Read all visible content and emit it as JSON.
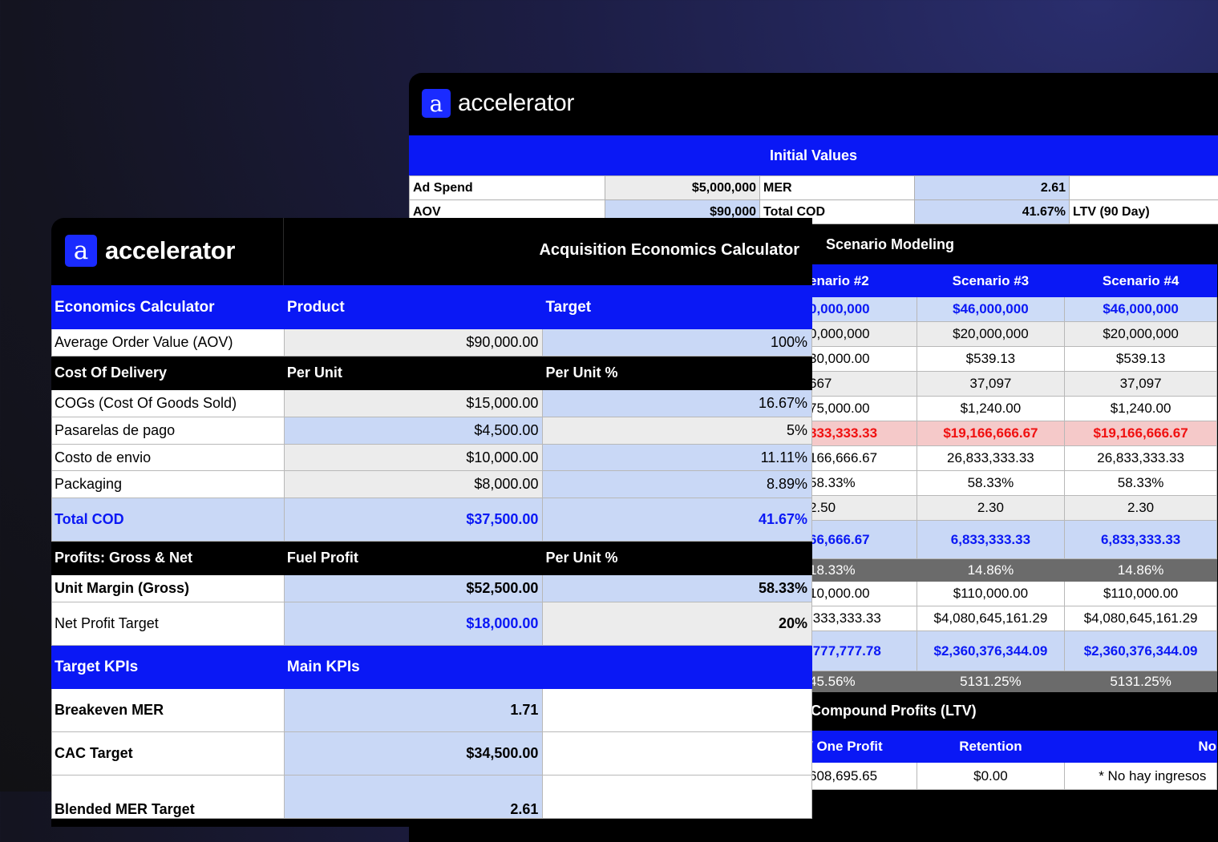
{
  "brand": {
    "mark": "a",
    "name": "accelerator"
  },
  "initial_values": {
    "header": "Initial Values",
    "rows": [
      {
        "l1": "Ad Spend",
        "v1": "$5,000,000",
        "l2": "MER",
        "v2": "2.61",
        "l3": ""
      },
      {
        "l1": "AOV",
        "v1": "$90,000",
        "l2": "Total COD",
        "v2": "41.67%",
        "l3": "LTV (90 Day)"
      }
    ]
  },
  "scenario": {
    "title": "Scenario Modeling",
    "headers": [
      "enario #2",
      "Scenario #3",
      "Scenario #4"
    ],
    "rows": [
      {
        "style": "r-lb",
        "cells": [
          "0,000,000",
          "$46,000,000",
          "$46,000,000"
        ]
      },
      {
        "style": "r-g",
        "cells": [
          "0,000,000",
          "$20,000,000",
          "$20,000,000"
        ]
      },
      {
        "style": "r-w",
        "cells": [
          "30,000.00",
          "$539.13",
          "$539.13"
        ]
      },
      {
        "style": "r-g",
        "cells": [
          "667",
          "37,097",
          "37,097"
        ]
      },
      {
        "style": "r-w",
        "cells": [
          "75,000.00",
          "$1,240.00",
          "$1,240.00"
        ]
      },
      {
        "style": "r-red",
        "cells": [
          "833,333.33",
          "$19,166,666.67",
          "$19,166,666.67"
        ]
      },
      {
        "style": "r-w",
        "cells": [
          "166,666.67",
          "26,833,333.33",
          "26,833,333.33"
        ]
      },
      {
        "style": "r-w",
        "cells": [
          "58.33%",
          "58.33%",
          "58.33%"
        ]
      },
      {
        "style": "r-g",
        "cells": [
          "2.50",
          "2.30",
          "2.30"
        ]
      },
      {
        "style": "r-blue",
        "cells": [
          "66,666.67",
          "6,833,333.33",
          "6,833,333.33"
        ]
      },
      {
        "style": "r-dark",
        "cells": [
          "18.33%",
          "14.86%",
          "14.86%"
        ]
      },
      {
        "style": "r-w",
        "cells": [
          "10,000.00",
          "$110,000.00",
          "$110,000.00"
        ]
      },
      {
        "style": "r-w",
        "cells": [
          ",333,333.33",
          "$4,080,645,161.29",
          "$4,080,645,161.29"
        ]
      },
      {
        "style": "r-blue2",
        "cells": [
          ",777,777.78",
          "$2,360,376,344.09",
          "$2,360,376,344.09"
        ]
      },
      {
        "style": "r-dark2",
        "cells": [
          "45.56%",
          "5131.25%",
          "5131.25%"
        ]
      }
    ],
    "ltv_title": "Compound Profits (LTV)",
    "ltv_headers": [
      "/ One Profit",
      "Retention",
      "No"
    ],
    "ltv_row": [
      "608,695.65",
      "$0.00",
      "* No hay ingresos"
    ]
  },
  "calculator": {
    "title": "Acquisition Economics Calculator",
    "section1": {
      "h1": "Economics Calculator",
      "h2": "Product",
      "h3": "Target"
    },
    "aov": {
      "label": "Average Order Value (AOV)",
      "value": "$90,000.00",
      "pct": "100%"
    },
    "section2": {
      "h1": "Cost Of Delivery",
      "h2": "Per Unit",
      "h3": "Per Unit %"
    },
    "costs": [
      {
        "label": "COGs (Cost Of Goods Sold)",
        "value": "$15,000.00",
        "pct": "16.67%"
      },
      {
        "label": "Pasarelas de pago",
        "value": "$4,500.00",
        "pct": "5%"
      },
      {
        "label": "Costo de envio",
        "value": "$10,000.00",
        "pct": "11.11%"
      },
      {
        "label": "Packaging",
        "value": "$8,000.00",
        "pct": "8.89%"
      }
    ],
    "total_cod": {
      "label": "Total COD",
      "value": "$37,500.00",
      "pct": "41.67%"
    },
    "section3": {
      "h1": "Profits: Gross & Net",
      "h2": "Fuel Profit",
      "h3": "Per Unit %"
    },
    "unit_margin": {
      "label": "Unit Margin (Gross)",
      "value": "$52,500.00",
      "pct": "58.33%"
    },
    "net_profit": {
      "label": "Net Profit Target",
      "value": "$18,000.00",
      "pct": "20%"
    },
    "section4": {
      "h1": "Target KPIs",
      "h2": "Main KPIs"
    },
    "kpis": [
      {
        "label": "Breakeven MER",
        "value": "1.71"
      },
      {
        "label": "CAC Target",
        "value": "$34,500.00"
      },
      {
        "label": "Blended MER Target",
        "value": "2.61"
      }
    ]
  },
  "colors": {
    "accent": "#0a18f5",
    "light_blue": "#c9d8f6",
    "alert_red": "#f01010"
  }
}
